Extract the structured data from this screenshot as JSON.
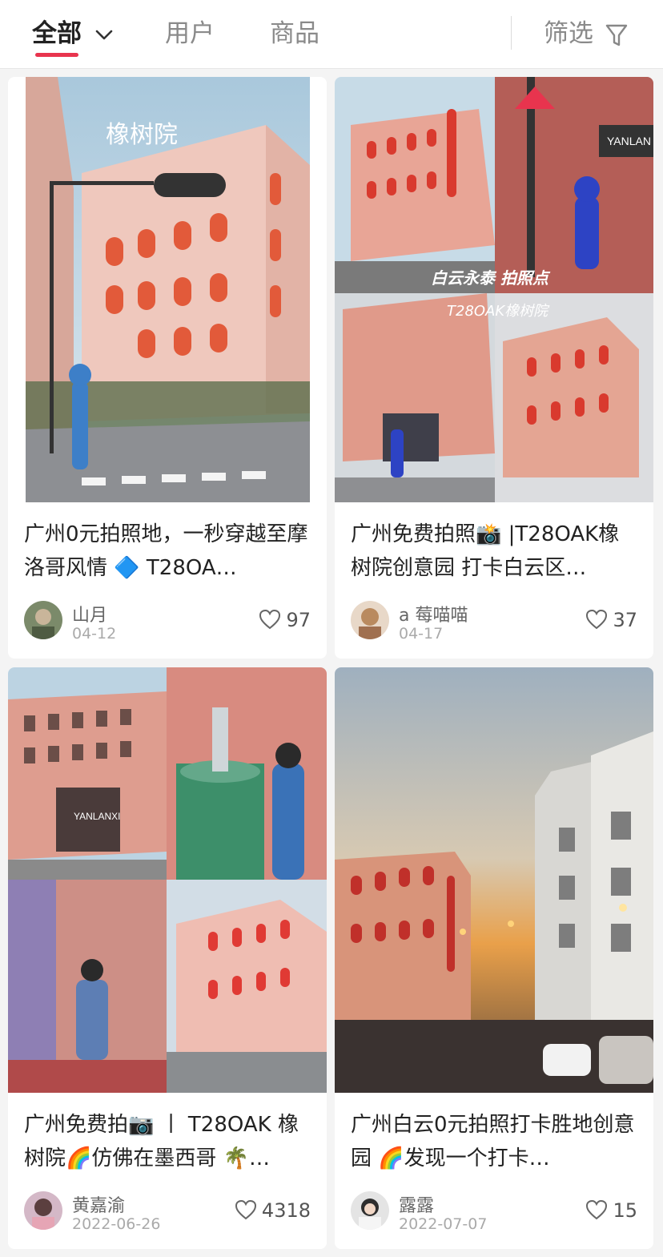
{
  "tabs": {
    "all": "全部",
    "users": "用户",
    "goods": "商品",
    "filter": "筛选"
  },
  "colors": {
    "accent": "#e8344e",
    "card_bg": "#ffffff",
    "page_bg": "#f4f4f4"
  },
  "icons": {
    "dropdown": "chevron-down-icon",
    "filter": "funnel-icon",
    "like": "heart-icon"
  },
  "posts": [
    {
      "image_text": "橡树院",
      "title": "广州0元拍照地，一秒穿越至摩洛哥风情 🔷 T28OA…",
      "author": "山月",
      "date": "04-12",
      "likes": "97"
    },
    {
      "image_text": "白云永泰 拍照点",
      "image_text_2": "T28OAK橡树院",
      "title": "广州免费拍照📸 |T28OAK橡树院创意园 打卡白云区…",
      "author": "a 莓喵喵",
      "date": "04-17",
      "likes": "37"
    },
    {
      "image_text": "YANLANXI",
      "title": "广州免费拍📷 丨 T28OAK 橡树院🌈仿佛在墨西哥 🌴…",
      "author": "黄嘉渝",
      "date": "2022-06-26",
      "likes": "4318"
    },
    {
      "image_text": "",
      "title": "广州白云0元拍照打卡胜地创意园 🌈发现一个打卡…",
      "author": "露露",
      "date": "2022-07-07",
      "likes": "15"
    }
  ]
}
